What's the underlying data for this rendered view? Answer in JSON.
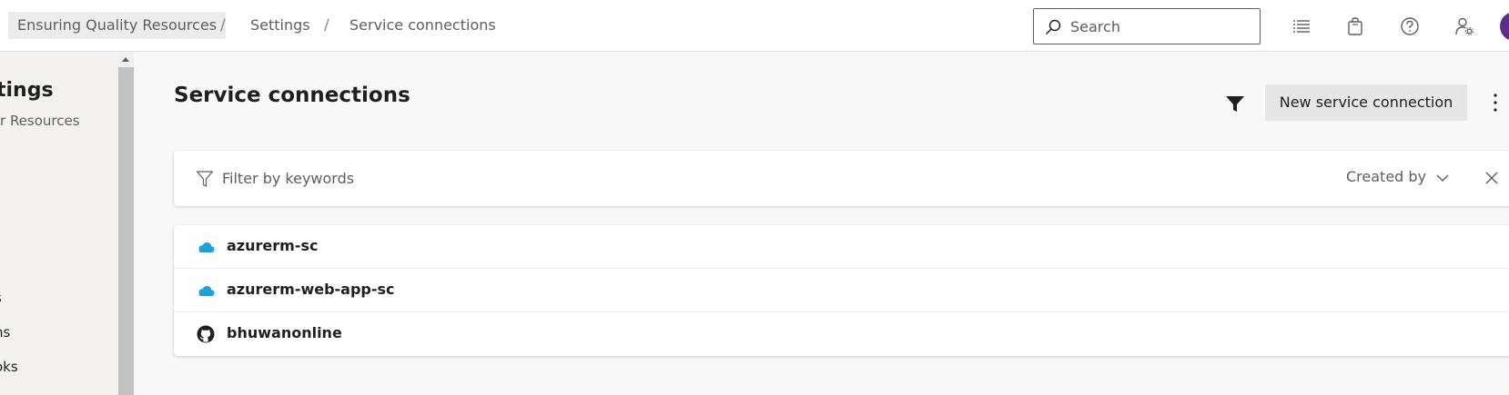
{
  "breadcrumb": {
    "items": [
      "Ensuring Quality Resources",
      "Settings",
      "Service connections"
    ],
    "separator": "/"
  },
  "search": {
    "placeholder": "Search",
    "value": ""
  },
  "header_icons": [
    "work-items-icon",
    "marketplace-bag-icon",
    "help-icon",
    "user-settings-icon",
    "avatar"
  ],
  "left_panel": {
    "title_partial": "tings",
    "subtitle_partial": "Resources",
    "items_partial": [
      "s",
      "ns",
      "oks"
    ]
  },
  "page": {
    "title": "Service connections",
    "new_button_label": "New service connection"
  },
  "filter": {
    "placeholder": "Filter by keywords",
    "created_by_label": "Created by"
  },
  "connections": [
    {
      "name": "azurerm-sc",
      "icon": "azure-cloud-icon"
    },
    {
      "name": "azurerm-web-app-sc",
      "icon": "azure-cloud-icon"
    },
    {
      "name": "bhuwanonline",
      "icon": "github-icon"
    }
  ],
  "colors": {
    "azure": "#1ba1e2",
    "avatar": "#5c2d91",
    "text": "#201f1e",
    "muted": "#605e5c"
  }
}
